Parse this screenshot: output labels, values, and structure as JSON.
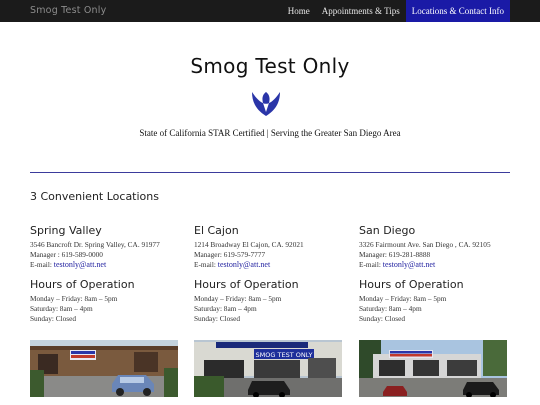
{
  "header": {
    "site_name": "Smog Test Only",
    "nav": [
      {
        "label": "Home"
      },
      {
        "label": "Appointments & Tips"
      },
      {
        "label": "Locations & Contact Info"
      }
    ]
  },
  "hero": {
    "title": "Smog Test Only",
    "tagline": "State of California STAR Certified | Serving the Greater San Diego Area",
    "logo_icon": "blue-emblem-icon"
  },
  "locations_heading": "3 Convenient Locations",
  "locations": [
    {
      "name": "Spring Valley",
      "address": "3546 Bancroft Dr. Spring Valley, CA. 91977",
      "manager": "Manager : 619-589-0000",
      "email_prefix": "E-mail: ",
      "email": "testonly@att.net",
      "hours_title": "Hours of Operation",
      "hours": [
        "Monday – Friday: 8am – 5pm",
        "Saturday: 8am – 4pm",
        "Sunday: Closed"
      ]
    },
    {
      "name": "El Cajon",
      "address": "1214 Broadway El Cajon, CA. 92021",
      "manager": "Manager: 619-579-7777",
      "email_prefix": "E-mail: ",
      "email": "testonly@att.net",
      "hours_title": "Hours of Operation",
      "hours": [
        "Monday – Friday: 8am – 5pm",
        "Saturday: 8am – 4pm",
        "Sunday: Closed"
      ],
      "photo_sign": "SMOG TEST ONLY"
    },
    {
      "name": "San Diego",
      "address": "3326 Fairmount Ave. San Diego , CA. 92105",
      "manager": "Manager: 619-281-8888",
      "email_prefix": "E-mail: ",
      "email": "testonly@att.net",
      "hours_title": "Hours of Operation",
      "hours": [
        "Monday – Friday: 8am – 5pm",
        "Saturday: 8am – 4pm",
        "Sunday: Closed"
      ]
    }
  ],
  "colors": {
    "nav_bg": "#1b1b1b",
    "nav_active": "#1a1aa6",
    "rule": "#3b3b9c",
    "link": "#1c1c9e",
    "logo": "#2a35a8"
  }
}
